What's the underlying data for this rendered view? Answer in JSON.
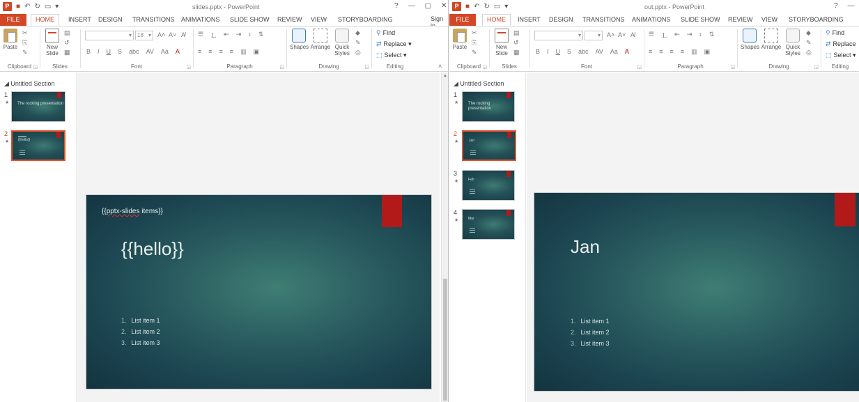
{
  "ribbon_common": {
    "tabs": [
      "FILE",
      "HOME",
      "INSERT",
      "DESIGN",
      "TRANSITIONS",
      "ANIMATIONS",
      "SLIDE SHOW",
      "REVIEW",
      "VIEW",
      "STORYBOARDING"
    ],
    "groups": {
      "clipboard": "Clipboard",
      "slides": "Slides",
      "font": "Font",
      "paragraph": "Paragraph",
      "drawing": "Drawing",
      "editing": "Editing"
    },
    "buttons": {
      "paste": "Paste",
      "new_slide": "New Slide",
      "shapes": "Shapes",
      "arrange": "Arrange",
      "quick_styles": "Quick Styles",
      "find": "Find",
      "replace": "Replace",
      "select": "Select"
    },
    "font_size": "18"
  },
  "left_window": {
    "title": "slides.pptx - PowerPoint",
    "sign_in": "Sign in",
    "section_title": "Untitled Section",
    "thumbnails": [
      {
        "number": "1",
        "text": "The rocking presentation",
        "selected": false
      },
      {
        "number": "2",
        "text": "{{hello}}",
        "selected": true
      }
    ],
    "slide": {
      "repeat_tag_prefix": "{{",
      "repeat_tag_word": "pptx-slides",
      "repeat_tag_suffix": " items}}",
      "title": "{{hello}}",
      "list": [
        {
          "n": "1.",
          "text": "List item 1"
        },
        {
          "n": "2.",
          "text": "List item 2"
        },
        {
          "n": "3.",
          "text": "List item 3"
        }
      ]
    }
  },
  "right_window": {
    "title": "out.pptx - PowerPoint",
    "section_title": "Untitled Section",
    "thumbnails": [
      {
        "number": "1",
        "text": "The rocking presentation",
        "selected": false
      },
      {
        "number": "2",
        "text": "Jan",
        "selected": true
      },
      {
        "number": "3",
        "text": "Feb",
        "selected": false
      },
      {
        "number": "4",
        "text": "Mar",
        "selected": false
      }
    ],
    "slide": {
      "title": "Jan",
      "list": [
        {
          "n": "1.",
          "text": "List item 1"
        },
        {
          "n": "2.",
          "text": "List item 2"
        },
        {
          "n": "3.",
          "text": "List item 3"
        }
      ]
    }
  },
  "colors": {
    "accent": "#d24726",
    "slide_bg_dark": "#14343f",
    "slide_bg_light": "#3f7e74",
    "flag_red": "#b21a1a"
  }
}
